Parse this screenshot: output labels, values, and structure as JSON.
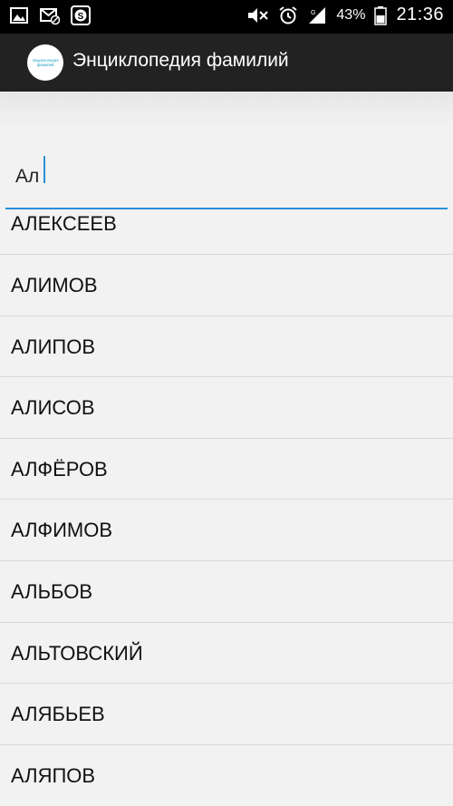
{
  "status_bar": {
    "icons_left": [
      "image-icon",
      "mail-off-icon",
      "s-app-icon"
    ],
    "icons_right": [
      "mute-icon",
      "alarm-icon",
      "signal-icon",
      "battery-icon"
    ],
    "battery": "43%",
    "time": "21:36"
  },
  "app_bar": {
    "logo_text_line1": "Энциклопедия",
    "logo_text_line2": "фамилий",
    "title": "Энциклопедия фамилий",
    "accent_color": "#2a8fd6"
  },
  "search": {
    "value": "Ал"
  },
  "results": [
    {
      "label": "АЛЕКСЕЕВ"
    },
    {
      "label": "АЛИМОВ"
    },
    {
      "label": "АЛИПОВ"
    },
    {
      "label": "АЛИСОВ"
    },
    {
      "label": "АЛФЁРОВ"
    },
    {
      "label": "АЛФИМОВ"
    },
    {
      "label": "АЛЬБОВ"
    },
    {
      "label": "АЛЬТОВСКИЙ"
    },
    {
      "label": "АЛЯБЬЕВ"
    },
    {
      "label": "АЛЯПОВ"
    }
  ]
}
